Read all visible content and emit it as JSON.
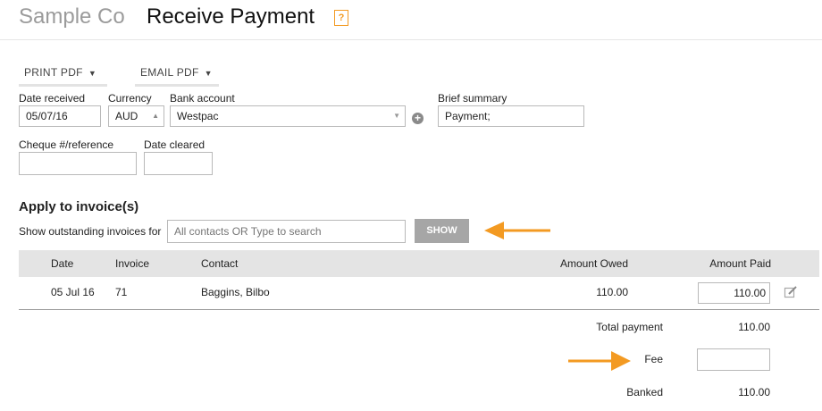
{
  "header": {
    "company": "Sample Co",
    "title": "Receive Payment",
    "help_label": "?"
  },
  "toolbar": {
    "print_label": "PRINT PDF",
    "email_label": "EMAIL PDF"
  },
  "form": {
    "date_received": {
      "label": "Date received",
      "value": "05/07/16"
    },
    "currency": {
      "label": "Currency",
      "value": "AUD"
    },
    "bank_account": {
      "label": "Bank account",
      "value": "Westpac"
    },
    "brief_summary": {
      "label": "Brief summary",
      "value": "Payment;"
    },
    "cheque_ref": {
      "label": "Cheque #/reference",
      "value": ""
    },
    "date_cleared": {
      "label": "Date cleared",
      "value": ""
    }
  },
  "apply": {
    "heading": "Apply to invoice(s)",
    "show_label": "Show outstanding invoices for",
    "search_placeholder": "All contacts OR Type to search",
    "show_button": "SHOW"
  },
  "table": {
    "columns": [
      "Date",
      "Invoice",
      "Contact",
      "Amount Owed",
      "Amount Paid"
    ],
    "rows": [
      {
        "date": "05 Jul 16",
        "invoice": "71",
        "contact": "Baggins, Bilbo",
        "amount_owed": "110.00",
        "amount_paid": "110.00"
      }
    ]
  },
  "totals": {
    "total_payment_label": "Total payment",
    "total_payment_value": "110.00",
    "fee_label": "Fee",
    "fee_value": "",
    "banked_label": "Banked",
    "banked_value": "110.00"
  },
  "icons": {
    "dropdown": "caret-down-icon",
    "add": "plus-circle-icon",
    "edit": "edit-icon",
    "arrow": "arrow-left-icon"
  },
  "colors": {
    "accent": "#f39a22",
    "show_button": "#a6a6a6",
    "table_header": "#e4e4e4"
  }
}
